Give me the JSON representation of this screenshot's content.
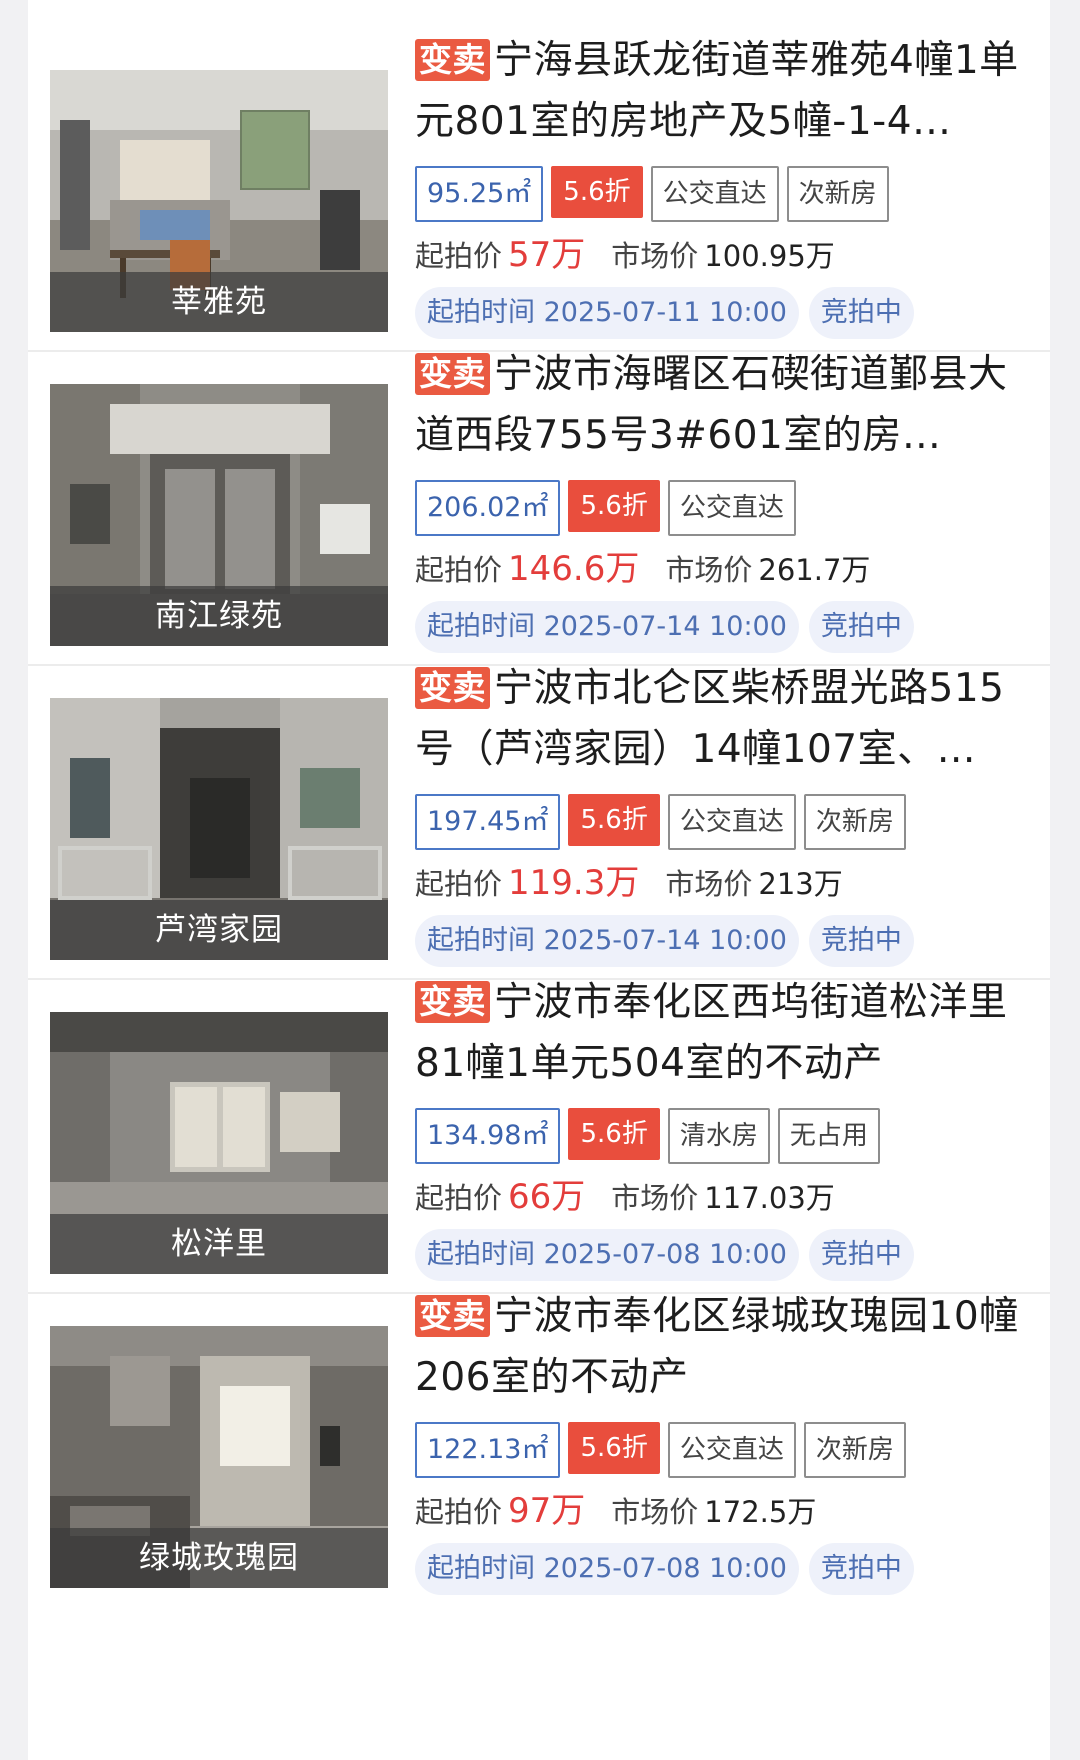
{
  "listings": [
    {
      "sale_tag": "变卖",
      "title": "宁海县跃龙街道莘雅苑4幢1单元801室的房地产及5幢-1-4…",
      "image_caption": "莘雅苑",
      "area": "95.25㎡",
      "discount": "5.6折",
      "features": [
        "公交直达",
        "次新房"
      ],
      "start_price_label": "起拍价",
      "start_price": "57万",
      "market_price_label": "市场价",
      "market_price": "100.95万",
      "start_time_label": "起拍时间",
      "start_time": "2025-07-11 10:00",
      "status": "竞拍中"
    },
    {
      "sale_tag": "变卖",
      "title": "宁波市海曙区石碶街道鄞县大道西段755号3#601室的房…",
      "image_caption": "南江绿苑",
      "area": "206.02㎡",
      "discount": "5.6折",
      "features": [
        "公交直达"
      ],
      "start_price_label": "起拍价",
      "start_price": "146.6万",
      "market_price_label": "市场价",
      "market_price": "261.7万",
      "start_time_label": "起拍时间",
      "start_time": "2025-07-14 10:00",
      "status": "竞拍中"
    },
    {
      "sale_tag": "变卖",
      "title": "宁波市北仑区柴桥盟光路515号（芦湾家园）14幢107室、…",
      "image_caption": "芦湾家园",
      "area": "197.45㎡",
      "discount": "5.6折",
      "features": [
        "公交直达",
        "次新房"
      ],
      "start_price_label": "起拍价",
      "start_price": "119.3万",
      "market_price_label": "市场价",
      "market_price": "213万",
      "start_time_label": "起拍时间",
      "start_time": "2025-07-14 10:00",
      "status": "竞拍中"
    },
    {
      "sale_tag": "变卖",
      "title": "宁波市奉化区西坞街道松洋里81幢1单元504室的不动产",
      "image_caption": "松洋里",
      "area": "134.98㎡",
      "discount": "5.6折",
      "features": [
        "清水房",
        "无占用"
      ],
      "start_price_label": "起拍价",
      "start_price": "66万",
      "market_price_label": "市场价",
      "market_price": "117.03万",
      "start_time_label": "起拍时间",
      "start_time": "2025-07-08 10:00",
      "status": "竞拍中"
    },
    {
      "sale_tag": "变卖",
      "title": "宁波市奉化区绿城玫瑰园10幢206室的不动产",
      "image_caption": "绿城玫瑰园",
      "area": "122.13㎡",
      "discount": "5.6折",
      "features": [
        "公交直达",
        "次新房"
      ],
      "start_price_label": "起拍价",
      "start_price": "97万",
      "market_price_label": "市场价",
      "market_price": "172.5万",
      "start_time_label": "起拍时间",
      "start_time": "2025-07-08 10:00",
      "status": "竞拍中"
    }
  ]
}
